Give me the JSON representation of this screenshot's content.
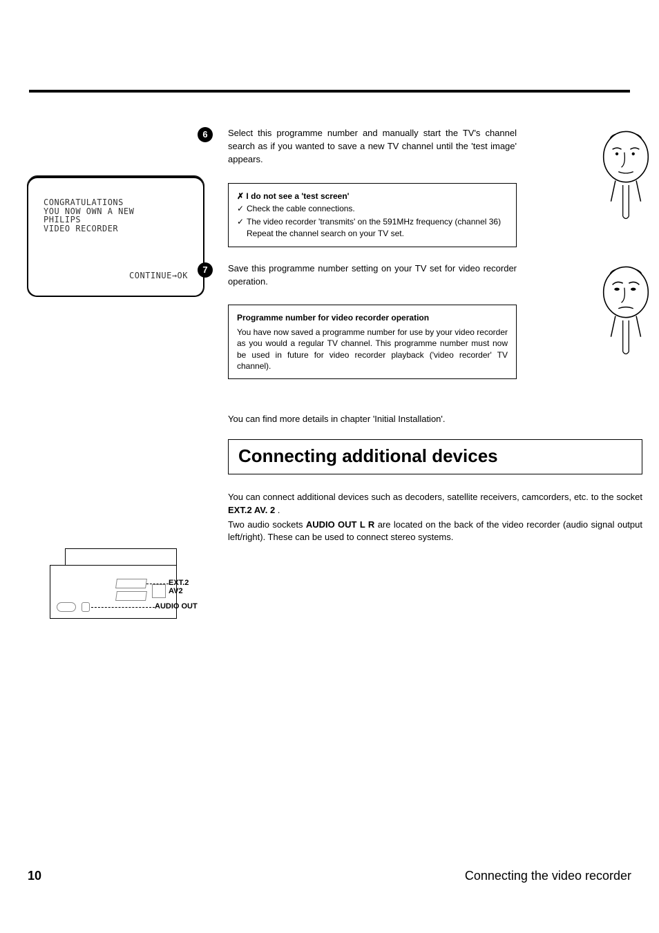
{
  "tv_screen": {
    "line1": "CONGRATULATIONS",
    "line2": "YOU NOW OWN A NEW",
    "line3": "PHILIPS",
    "line4": "VIDEO RECORDER",
    "continue": "CONTINUE→OK"
  },
  "step6": {
    "num": "6",
    "text": "Select this programme number and manually start the TV's channel search as if you wanted to save a new TV channel until the 'test image' appears."
  },
  "trouble": {
    "title_prefix": "✗",
    "title": "I do not see a 'test screen'",
    "bullet1_prefix": "✓",
    "bullet1": "Check the cable connections.",
    "bullet2_prefix": "✓",
    "bullet2": "The video recorder 'transmits' on the 591MHz frequency (channel 36)",
    "bullet2b": "Repeat the channel search on your TV set."
  },
  "step7": {
    "num": "7",
    "text": "Save this programme number setting on your TV set for video recorder operation."
  },
  "info": {
    "title": "Programme number for video recorder operation",
    "body": "You have now saved a programme number for use by your video recorder as you would a regular TV channel. This programme number must now be used in future for video recorder playback ('video recorder' TV channel)."
  },
  "note": "You can find more details in chapter 'Initial Installation'.",
  "section": {
    "title": "Connecting additional devices"
  },
  "para1_a": "You can connect additional devices such as decoders, satellite receivers, camcorders, etc. to the socket ",
  "para1_bold": "EXT.2 AV. 2",
  "para1_b": " .",
  "para2_a": "Two audio sockets ",
  "para2_bold": "AUDIO OUT L R",
  "para2_b": " are located on the back of the video recorder (audio signal output left/right). These can be used to connect stereo systems.",
  "diagram": {
    "label1": "EXT.2 AV2",
    "label2": "AUDIO OUT"
  },
  "footer": {
    "page": "10",
    "title": "Connecting the video recorder"
  }
}
